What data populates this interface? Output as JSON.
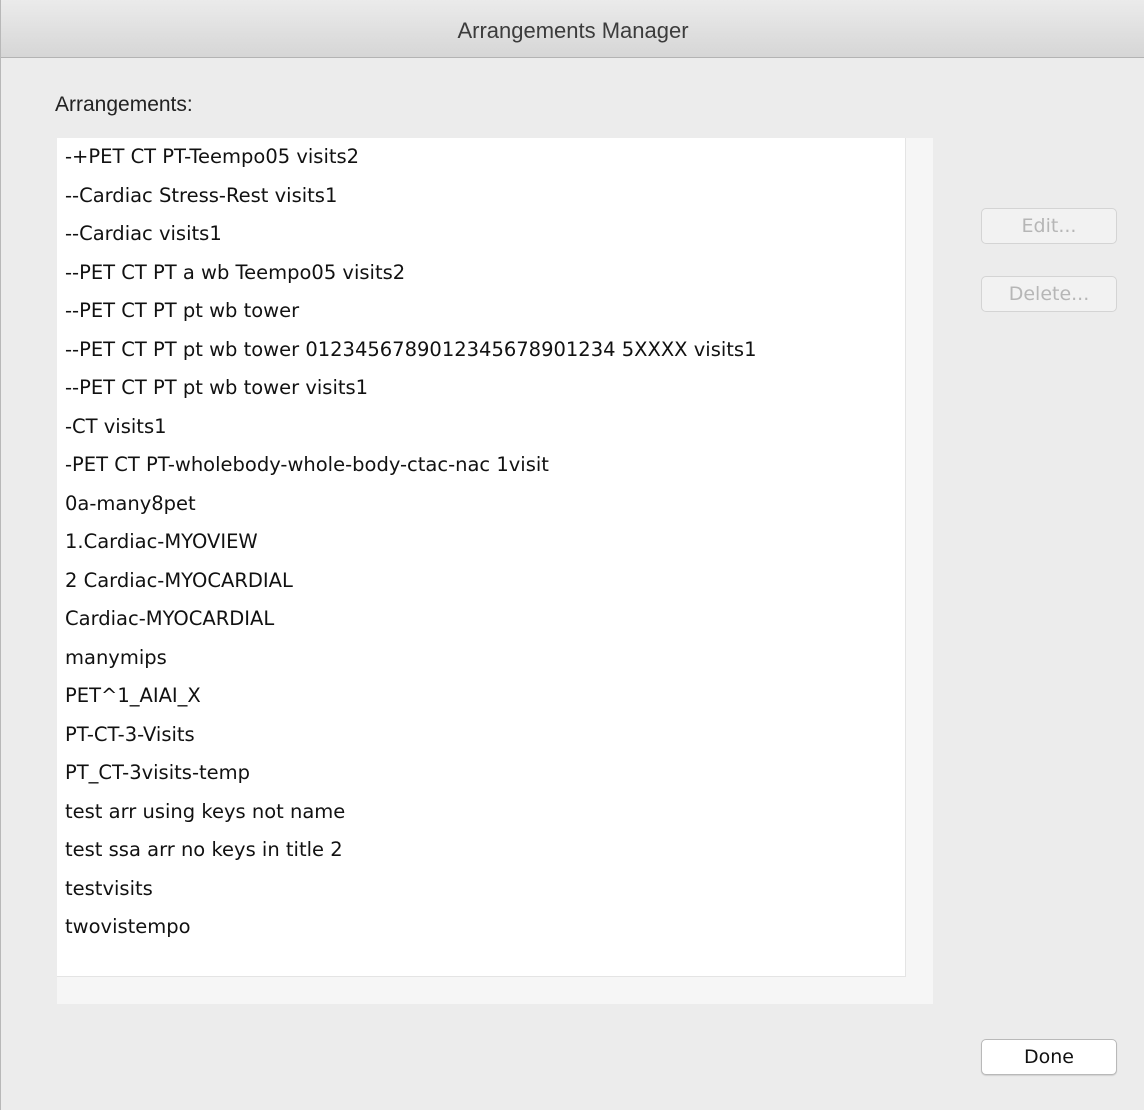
{
  "window": {
    "title": "Arrangements Manager"
  },
  "list": {
    "label": "Arrangements:",
    "items": [
      "-+PET CT PT-Teempo05 visits2",
      "--Cardiac Stress-Rest visits1",
      "--Cardiac visits1",
      "--PET CT PT a wb Teempo05 visits2",
      "--PET CT PT pt wb tower",
      "--PET CT PT pt wb tower 0123456789012345678901234 5XXXX visits1",
      "--PET CT PT pt wb tower visits1",
      "-CT visits1",
      "-PET CT PT-wholebody-whole-body-ctac-nac 1visit",
      "0a-many8pet",
      "1.Cardiac-MYOVIEW",
      "2 Cardiac-MYOCARDIAL",
      "Cardiac-MYOCARDIAL",
      "manymips",
      "PET^1_AIAI_X",
      "PT-CT-3-Visits",
      "PT_CT-3visits-temp",
      "test arr using keys not name",
      "test ssa arr no keys in title 2",
      "testvisits",
      "twovistempo"
    ]
  },
  "buttons": {
    "edit": "Edit...",
    "delete": "Delete...",
    "done": "Done"
  }
}
